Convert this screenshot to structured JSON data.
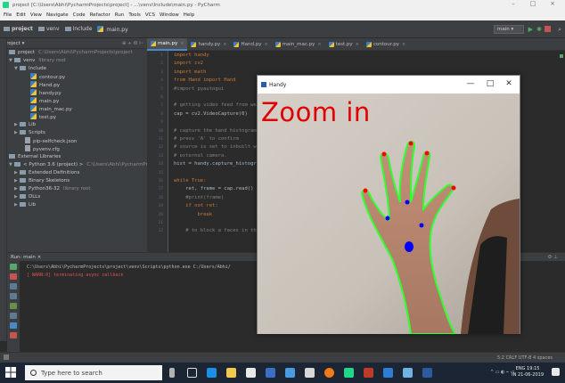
{
  "window": {
    "title": "project [C:\\Users\\Abhi\\PycharmProjects\\project] - ...\\venv\\Include\\main.py - PyCharm",
    "controls": [
      "–",
      "□",
      "×"
    ]
  },
  "menu": [
    "File",
    "Edit",
    "View",
    "Navigate",
    "Code",
    "Refactor",
    "Run",
    "Tools",
    "VCS",
    "Window",
    "Help"
  ],
  "navbar": {
    "crumbs": [
      "project",
      "venv",
      "Include",
      "main.py"
    ],
    "run_config": "main"
  },
  "project_panel": {
    "header": "Project ▾",
    "tree": [
      {
        "indent": 0,
        "arrow": "▼",
        "icon": "folder",
        "label": "project",
        "hint": "C:\\Users\\Abhi\\PycharmProjects\\project"
      },
      {
        "indent": 1,
        "arrow": "▼",
        "icon": "folder",
        "label": "venv",
        "hint": "library root"
      },
      {
        "indent": 2,
        "arrow": "▼",
        "icon": "folder",
        "label": "Include",
        "hint": ""
      },
      {
        "indent": 4,
        "arrow": "",
        "icon": "py",
        "label": "contour.py",
        "hint": ""
      },
      {
        "indent": 4,
        "arrow": "",
        "icon": "py",
        "label": "Hand.py",
        "hint": ""
      },
      {
        "indent": 4,
        "arrow": "",
        "icon": "py",
        "label": "handy.py",
        "hint": ""
      },
      {
        "indent": 4,
        "arrow": "",
        "icon": "py",
        "label": "main.py",
        "hint": ""
      },
      {
        "indent": 4,
        "arrow": "",
        "icon": "py",
        "label": "main_mac.py",
        "hint": ""
      },
      {
        "indent": 4,
        "arrow": "",
        "icon": "py",
        "label": "test.py",
        "hint": ""
      },
      {
        "indent": 2,
        "arrow": "▶",
        "icon": "folder",
        "label": "Lib",
        "hint": ""
      },
      {
        "indent": 2,
        "arrow": "▶",
        "icon": "folder",
        "label": "Scripts",
        "hint": ""
      },
      {
        "indent": 3,
        "arrow": "",
        "icon": "file",
        "label": "pip-selfcheck.json",
        "hint": ""
      },
      {
        "indent": 3,
        "arrow": "",
        "icon": "file",
        "label": "pyvenv.cfg",
        "hint": ""
      },
      {
        "indent": 0,
        "arrow": "▼",
        "icon": "folder",
        "label": "External Libraries",
        "hint": ""
      },
      {
        "indent": 1,
        "arrow": "▼",
        "icon": "folder",
        "label": "< Python 3.6 (project) >",
        "hint": "C:\\Users\\Abhi\\PycharmProje"
      },
      {
        "indent": 2,
        "arrow": "▶",
        "icon": "folder",
        "label": "Extended Definitions",
        "hint": ""
      },
      {
        "indent": 2,
        "arrow": "▶",
        "icon": "folder",
        "label": "Binary Skeletons",
        "hint": ""
      },
      {
        "indent": 2,
        "arrow": "▶",
        "icon": "folder",
        "label": "Python36-32",
        "hint": "library root"
      },
      {
        "indent": 2,
        "arrow": "▶",
        "icon": "folder",
        "label": "DLLs",
        "hint": ""
      },
      {
        "indent": 2,
        "arrow": "▶",
        "icon": "folder",
        "label": "Lib",
        "hint": ""
      }
    ]
  },
  "editor_tabs": [
    {
      "label": "main.py",
      "active": true
    },
    {
      "label": "handy.py",
      "active": false
    },
    {
      "label": "Hand.py",
      "active": false
    },
    {
      "label": "main_mac.py",
      "active": false
    },
    {
      "label": "test.py",
      "active": false
    },
    {
      "label": "contour.py",
      "active": false
    }
  ],
  "code": [
    {
      "n": "1",
      "t": "import handy",
      "k": "kw"
    },
    {
      "n": "2",
      "t": "import cv2",
      "k": "kw"
    },
    {
      "n": "3",
      "t": "import math",
      "k": "kw"
    },
    {
      "n": "4",
      "t": "from Hand import Hand",
      "k": "kw"
    },
    {
      "n": "5",
      "t": "#import pyautogui",
      "k": "cm"
    },
    {
      "n": "6",
      "t": "",
      "k": ""
    },
    {
      "n": "7",
      "t": "# getting video feed from web",
      "k": "cm"
    },
    {
      "n": "8",
      "t": "cap = cv2.VideoCapture(0)",
      "k": ""
    },
    {
      "n": "9",
      "t": "",
      "k": ""
    },
    {
      "n": "10",
      "t": "# capture the hand histogram",
      "k": "cm"
    },
    {
      "n": "11",
      "t": "# press 'A' to confirm",
      "k": "cm"
    },
    {
      "n": "12",
      "t": "# source is set to inbuilt we",
      "k": "cm"
    },
    {
      "n": "13",
      "t": "# external camera.",
      "k": "cm"
    },
    {
      "n": "14",
      "t": "hist = handy.capture_histogra",
      "k": ""
    },
    {
      "n": "15",
      "t": "",
      "k": ""
    },
    {
      "n": "16",
      "t": "while True:",
      "k": "kw"
    },
    {
      "n": "17",
      "t": "    ret, frame = cap.read()",
      "k": ""
    },
    {
      "n": "18",
      "t": "    #print(frame)",
      "k": "cm"
    },
    {
      "n": "19",
      "t": "    if not ret:",
      "k": "kw"
    },
    {
      "n": "20",
      "t": "        break",
      "k": "kw"
    },
    {
      "n": "21",
      "t": "",
      "k": ""
    },
    {
      "n": "22",
      "t": "    # to block a faces in the",
      "k": "cm"
    }
  ],
  "run_panel": {
    "header": "Run:   main ×",
    "lines": [
      {
        "t": "C:\\Users\\Abhi\\PycharmProjects\\project\\venv\\Scripts\\python.exe C:/Users/Abhi/",
        "c": "#bbbbbb"
      },
      {
        "t": "[ WARN:0] terminating async callback",
        "c": "#d9534f"
      }
    ]
  },
  "status_bar": "5:2  CRLF  UTF-8  4 spaces",
  "hand_window": {
    "title": "Handy",
    "overlay": "Zoom in",
    "controls": [
      "—",
      "□",
      "✕"
    ]
  },
  "taskbar": {
    "search_placeholder": "Type here to search",
    "lang": "ENG",
    "region": "IN",
    "time": "19:15",
    "date": "21-06-2019"
  },
  "colors": {
    "ide_bg": "#2b2b2b",
    "panel_bg": "#3c3f41",
    "accent": "#4a88c7",
    "overlay_red": "#e00000",
    "contour_green": "#32ff32",
    "fingertip_red": "#ff0000",
    "defect_blue": "#0000ff"
  }
}
